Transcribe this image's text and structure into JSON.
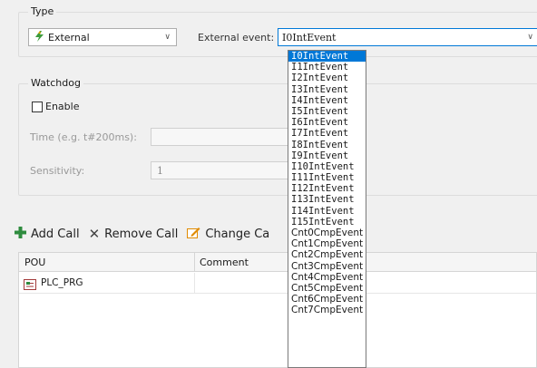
{
  "type_group": {
    "label": "Type",
    "type_value": "External",
    "external_event_label": "External event:",
    "external_event_value": "I0IntEvent"
  },
  "watchdog": {
    "label": "Watchdog",
    "enable_label": "Enable",
    "enable_checked": false,
    "time_label": "Time (e.g. t#200ms):",
    "time_value": "",
    "sensitivity_label": "Sensitivity:",
    "sensitivity_value": "1"
  },
  "toolbar": {
    "add_call": "Add Call",
    "remove_call": "Remove Call",
    "change_call": "Change Ca"
  },
  "table": {
    "columns": [
      "POU",
      "Comment"
    ],
    "rows": [
      {
        "pou": "PLC_PRG",
        "comment": ""
      }
    ]
  },
  "dropdown": {
    "selected_index": 0,
    "options": [
      "I0IntEvent",
      "I1IntEvent",
      "I2IntEvent",
      "I3IntEvent",
      "I4IntEvent",
      "I5IntEvent",
      "I6IntEvent",
      "I7IntEvent",
      "I8IntEvent",
      "I9IntEvent",
      "I10IntEvent",
      "I11IntEvent",
      "I12IntEvent",
      "I13IntEvent",
      "I14IntEvent",
      "I15IntEvent",
      "Cnt0CmpEvent",
      "Cnt1CmpEvent",
      "Cnt2CmpEvent",
      "Cnt3CmpEvent",
      "Cnt4CmpEvent",
      "Cnt5CmpEvent",
      "Cnt6CmpEvent",
      "Cnt7CmpEvent"
    ]
  },
  "colors": {
    "selection": "#0078d7",
    "add_icon": "#2e8b3e",
    "change_icon": "#e08a00"
  },
  "icons": [
    "lightning-icon",
    "chevron-down-icon",
    "plus-icon",
    "x-icon",
    "edit-icon",
    "pou-icon"
  ]
}
